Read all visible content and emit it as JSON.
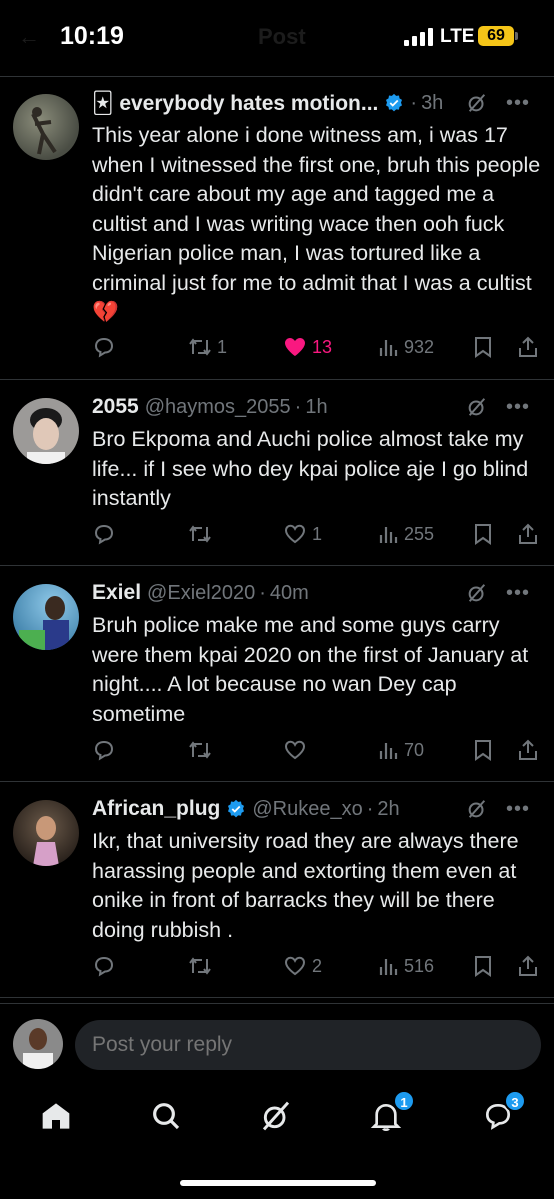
{
  "status_bar": {
    "time": "10:19",
    "network": "LTE",
    "battery": "69"
  },
  "header": {
    "back": "←",
    "title": "Post"
  },
  "tweets": [
    {
      "name": "🃏 everybody hates motion...",
      "handle": "",
      "verified": true,
      "time": "3h",
      "text": "This year alone i done witness am, i was 17 when I witnessed the first one, bruh this people didn't care about my age and tagged me a cultist and I was writing wace then ooh fuck Nigerian police man, I was tortured like a criminal just for me to admit that I was a cultist 💔",
      "reposts": "1",
      "likes": "13",
      "liked": true,
      "views": "932"
    },
    {
      "name": "2055",
      "handle": "@haymos_2055",
      "verified": false,
      "time": "1h",
      "text": "Bro Ekpoma and  Auchi police almost take my life... if I see who dey kpai police aje I go blind instantly",
      "reposts": "",
      "likes": "1",
      "liked": false,
      "views": "255"
    },
    {
      "name": "Exiel",
      "handle": "@Exiel2020",
      "verified": false,
      "time": "40m",
      "text": "Bruh police make me and some guys carry were them kpai 2020 on the first of January at night.... A lot because no wan Dey cap sometime",
      "reposts": "",
      "likes": "",
      "liked": false,
      "views": "70"
    },
    {
      "name": "African_plug",
      "handle": "@Rukee_xo",
      "verified": true,
      "time": "2h",
      "text": "Ikr, that university road they are always there harassing people and extorting them even at onike in front of barracks they will be there doing rubbish .",
      "reposts": "",
      "likes": "2",
      "liked": false,
      "views": "516"
    }
  ],
  "reply": {
    "placeholder": "Post your reply"
  },
  "tabbar": {
    "items": [
      "home-icon",
      "search-icon",
      "grok-icon",
      "notifications-icon",
      "messages-icon"
    ],
    "notifications_badge": "1",
    "messages_badge": "3"
  },
  "colors": {
    "accent": "#1d9bf0",
    "like": "#f91880",
    "muted": "#71767b",
    "text": "#e7e9ea",
    "divider": "#2f3336",
    "battery": "#f5c518"
  }
}
